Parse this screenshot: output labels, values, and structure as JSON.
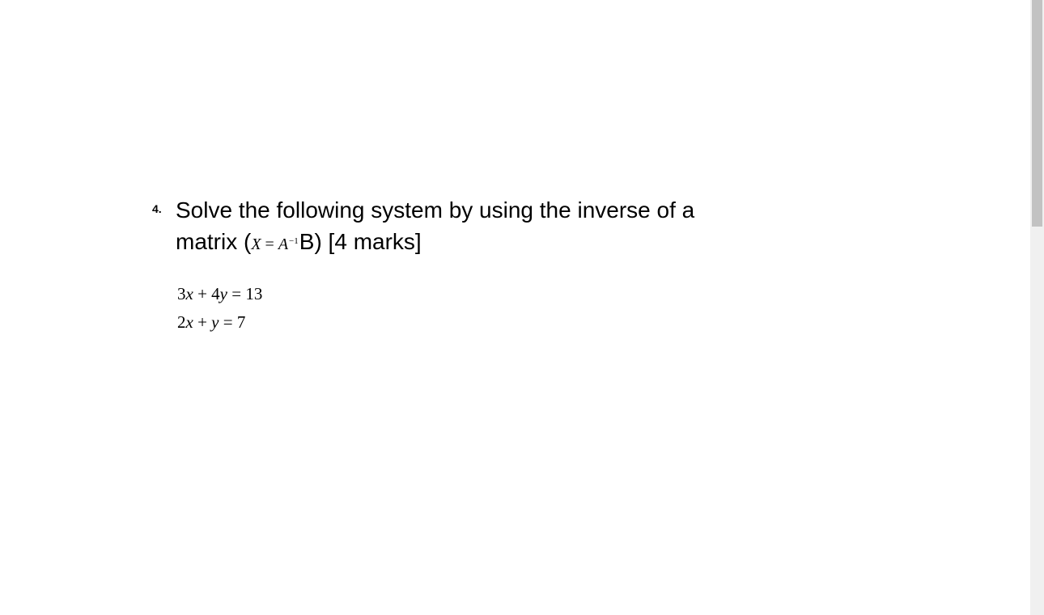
{
  "question": {
    "number": "4.",
    "text_part1": "Solve the following system by using the inverse of a",
    "text_part2a": "matrix (",
    "formula": {
      "X": "X",
      "eq": " = ",
      "A": "A",
      "exp": "−1",
      "B": "B"
    },
    "text_part2b": ") [4 marks]",
    "equations": {
      "eq1_a": "3",
      "eq1_x": "x",
      "eq1_b": " + 4",
      "eq1_y": "y",
      "eq1_c": " = 13",
      "eq2_a": "2",
      "eq2_x": "x",
      "eq2_b": " + ",
      "eq2_y": "y",
      "eq2_c": " = 7"
    }
  }
}
